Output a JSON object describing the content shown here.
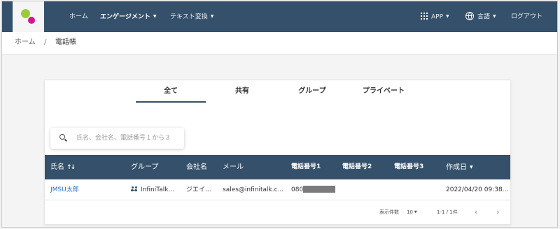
{
  "nav": {
    "home": "ホーム",
    "engagement": "エンゲージメント",
    "text_convert": "テキスト変換",
    "app": "APP",
    "language": "言語",
    "logout": "ログアウト"
  },
  "breadcrumb": {
    "home": "ホーム",
    "separator": "/",
    "current": "電話帳"
  },
  "tabs": [
    "全て",
    "共有",
    "グループ",
    "プライベート"
  ],
  "search": {
    "placeholder": "氏名、会社名、電話番号１から３"
  },
  "table": {
    "headers": [
      "氏名",
      "グループ",
      "会社名",
      "メール",
      "電話番号1",
      "電話番号2",
      "電話番号3",
      "作成日"
    ],
    "rows": [
      {
        "name": "JMSU太郎",
        "group": "InfiniTalk...",
        "company": "ジエイ...",
        "email": "sales@infinitalk.c...",
        "phone1": "080",
        "phone2": "",
        "phone3": "",
        "created": "2022/04/20 09:38..."
      }
    ]
  },
  "footer": {
    "rows_label": "表示件数",
    "rows_value": "10",
    "range": "1-1 / 1件"
  },
  "colors": {
    "header": "#34506b",
    "link": "#2f6fb0",
    "logo_green": "#9bcb3c",
    "logo_pink": "#d6158c"
  }
}
